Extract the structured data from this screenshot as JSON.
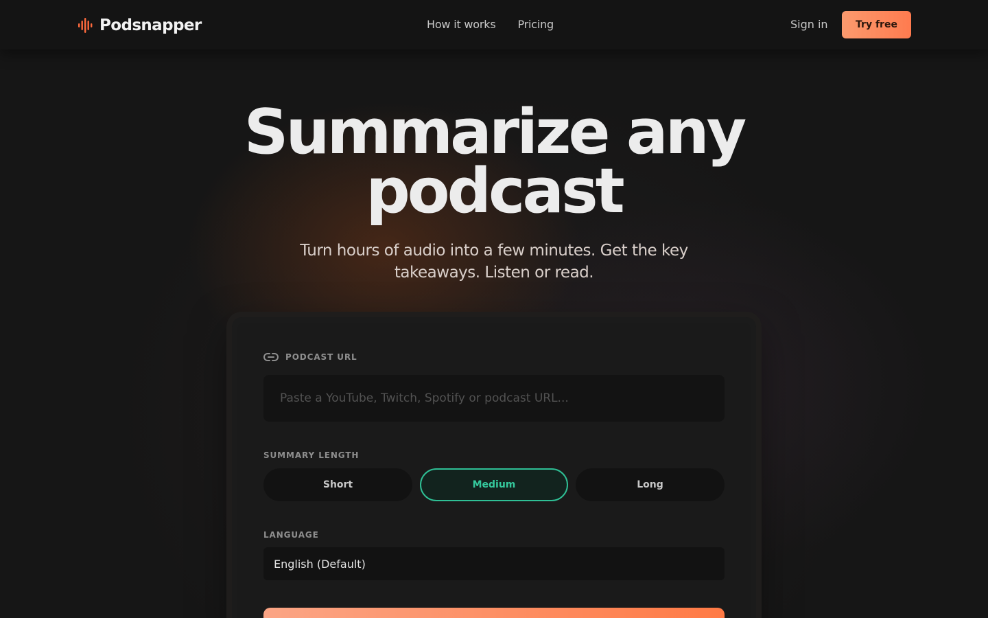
{
  "header": {
    "brand": {
      "name": "Podsnapper",
      "icon": "soundwave-icon",
      "icon_color": "#ff6a3d"
    },
    "nav": [
      {
        "label": "How it works"
      },
      {
        "label": "Pricing"
      }
    ],
    "sign_in_label": "Sign in",
    "cta_label": "Try free"
  },
  "hero": {
    "title_line1": "Summarize any",
    "title_line2": "podcast",
    "subtitle": "Turn hours of audio into a few minutes. Get the key takeaways. Listen or read."
  },
  "form": {
    "url": {
      "label": "PODCAST URL",
      "icon": "link-icon",
      "placeholder": "Paste a YouTube, Twitch, Spotify or podcast URL...",
      "value": ""
    },
    "summary_length": {
      "label": "SUMMARY LENGTH",
      "options": [
        "Short",
        "Medium",
        "Long"
      ],
      "selected": "Medium"
    },
    "language": {
      "label": "LANGUAGE",
      "selected": "English (Default)"
    },
    "submit_label": ""
  },
  "colors": {
    "accent": "#ff7b4f",
    "selected": "#2fbf95",
    "background": "#161616"
  }
}
